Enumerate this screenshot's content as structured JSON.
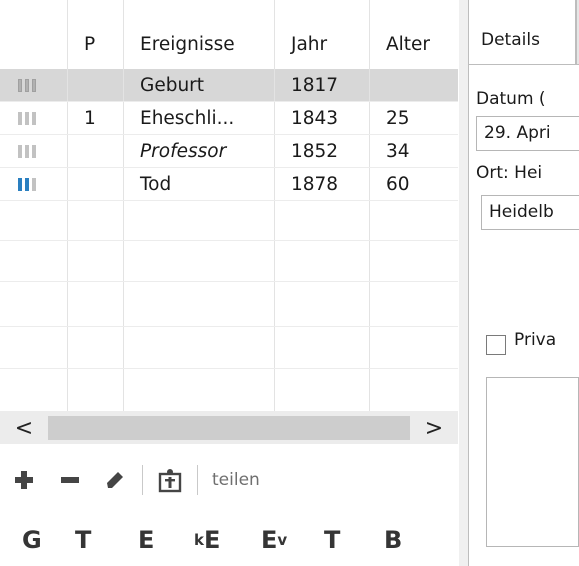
{
  "grid": {
    "columns": [
      "",
      "P",
      "Ereignisse",
      "Jahr",
      "Alter"
    ],
    "rows": [
      {
        "p": "",
        "event": "Geburt",
        "year": "1817",
        "age": "",
        "selected": true,
        "italic": false
      },
      {
        "p": "1",
        "event": "Eheschli...",
        "year": "1843",
        "age": "25",
        "selected": false,
        "italic": false
      },
      {
        "p": "",
        "event": "Professor",
        "year": "1852",
        "age": "34",
        "selected": false,
        "italic": true
      },
      {
        "p": "",
        "event": "Tod",
        "year": "1878",
        "age": "60",
        "selected": false,
        "italic": false
      }
    ]
  },
  "scrollbar": {
    "left_arrow": "<",
    "right_arrow": ">"
  },
  "toolbar": {
    "add_icon": "plus-icon",
    "remove_icon": "minus-icon",
    "edit_icon": "pencil-icon",
    "person_icon": "person-icon",
    "share_label": "teilen"
  },
  "letters": [
    "G",
    "T",
    "E",
    "kE",
    "Ev",
    "T",
    "B"
  ],
  "details": {
    "tab_label": "Details",
    "datum_label": "Datum (",
    "datum_value": "29. Apri",
    "ort_label": "Ort: Hei",
    "ort_value": "Heidelb",
    "privat_label": "Priva"
  },
  "colors": {
    "accent_bar": "#2a7fc0",
    "selected_row": "#d7d7d7"
  }
}
